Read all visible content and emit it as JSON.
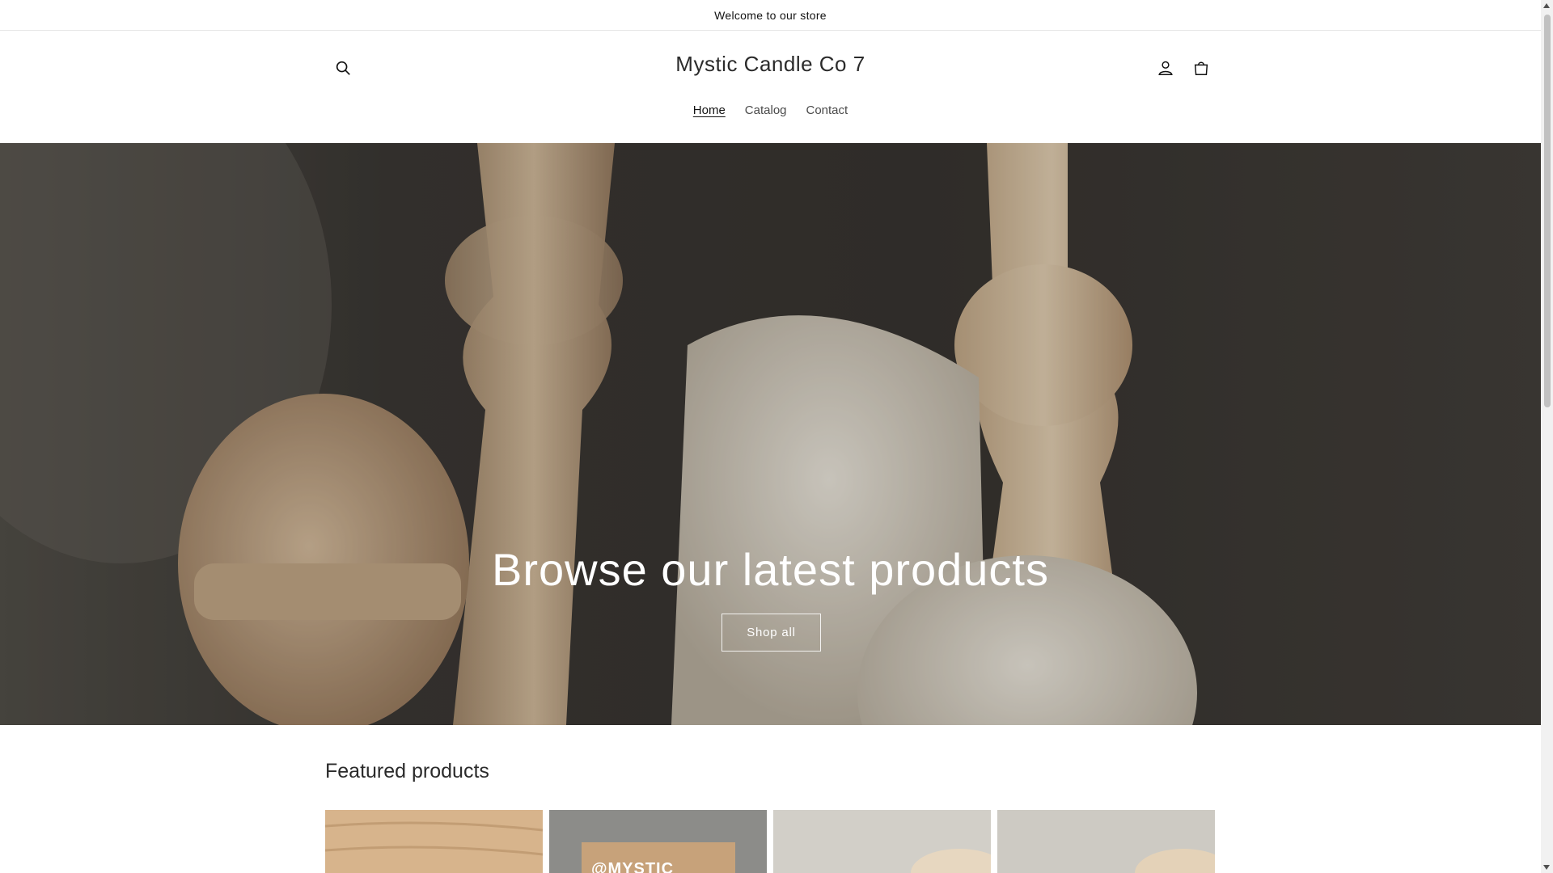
{
  "announcement": {
    "text": "Welcome to our store"
  },
  "header": {
    "store_name": "Mystic Candle Co 7",
    "icons": {
      "search": "search-icon",
      "account": "account-icon",
      "cart": "cart-icon"
    }
  },
  "nav": {
    "items": [
      {
        "label": "Home",
        "active": true
      },
      {
        "label": "Catalog",
        "active": false
      },
      {
        "label": "Contact",
        "active": false
      }
    ]
  },
  "hero": {
    "heading": "Browse our latest products",
    "button_label": "Shop all"
  },
  "featured": {
    "title": "Featured products",
    "stamp_text": "@MYSTIC"
  },
  "colors": {
    "text": "#121212",
    "border": "#e6e6e6",
    "hero_overlay_text": "#ffffff"
  }
}
